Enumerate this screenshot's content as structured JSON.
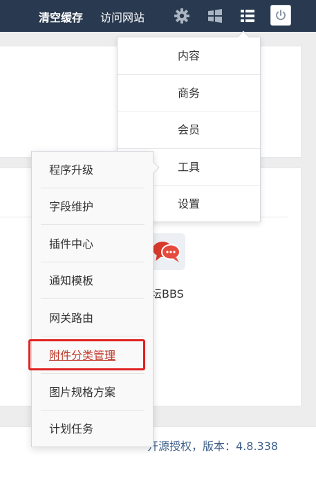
{
  "topbar": {
    "clear_cache": "清空缓存",
    "visit_site": "访问网站",
    "icons": [
      "gear-icon",
      "windows-icon",
      "menu-list-icon",
      "power-icon"
    ],
    "bg_color": "#29394f"
  },
  "main_menu": {
    "items": [
      {
        "label": "内容"
      },
      {
        "label": "商务"
      },
      {
        "label": "会员"
      },
      {
        "label": "工具"
      },
      {
        "label": "设置"
      }
    ]
  },
  "sub_menu": {
    "items": [
      {
        "label": "程序升级"
      },
      {
        "label": "字段维护"
      },
      {
        "label": "插件中心"
      },
      {
        "label": "通知模板"
      },
      {
        "label": "网关路由"
      },
      {
        "label": "附件分类管理",
        "active": true
      },
      {
        "label": "图片规格方案"
      },
      {
        "label": "计划任务"
      }
    ],
    "highlight_color": "#e02020"
  },
  "background": {
    "app_label": "坛BBS",
    "app_icon": "chat-bubbles-icon",
    "license": "开源授权，版本：4.8.338"
  }
}
